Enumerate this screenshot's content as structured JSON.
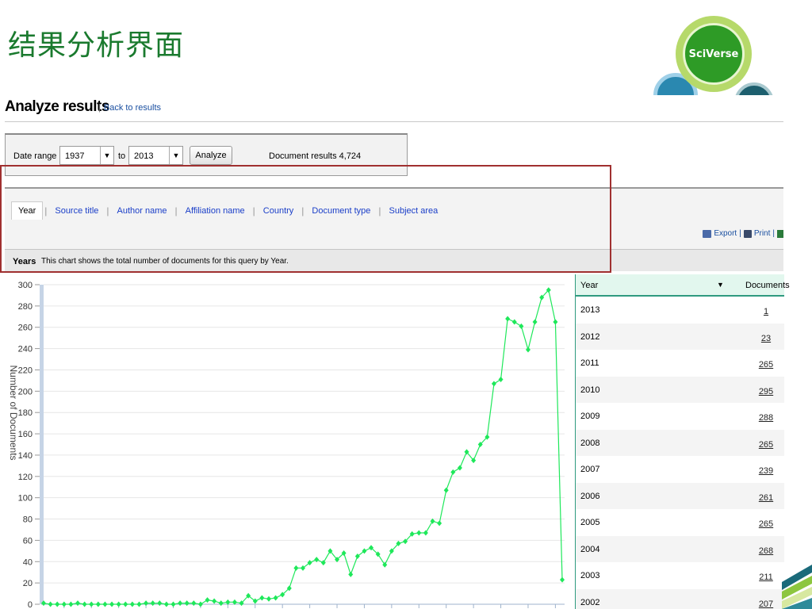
{
  "slide": {
    "title": "结果分析界面"
  },
  "logo": {
    "label": "SciVerse"
  },
  "page": {
    "title": "Analyze results",
    "back_link": "Back to results",
    "separator": "|"
  },
  "date_range": {
    "label": "Date range",
    "from": "1937",
    "to_label": "to",
    "to": "2013",
    "analyze_label": "Analyze",
    "document_results": "Document results 4,724"
  },
  "tabs": [
    {
      "label": "Year",
      "active": true
    },
    {
      "label": "Source title",
      "active": false
    },
    {
      "label": "Author name",
      "active": false
    },
    {
      "label": "Affiliation name",
      "active": false
    },
    {
      "label": "Country",
      "active": false
    },
    {
      "label": "Document type",
      "active": false
    },
    {
      "label": "Subject area",
      "active": false
    }
  ],
  "tools": {
    "export": "Export",
    "print": "Print"
  },
  "section": {
    "heading": "Years",
    "description": "This chart shows the total number of documents for this query by Year."
  },
  "chart_data": {
    "type": "line",
    "ylabel": "Number of Documents",
    "ylim": [
      0,
      300
    ],
    "yticks": [
      0,
      20,
      40,
      60,
      80,
      100,
      120,
      140,
      160,
      180,
      200,
      220,
      240,
      260,
      280,
      300
    ],
    "grid": true,
    "series_color": "#1ee85a",
    "x": [
      1937,
      1938,
      1939,
      1940,
      1941,
      1942,
      1943,
      1944,
      1945,
      1946,
      1947,
      1948,
      1949,
      1950,
      1951,
      1952,
      1953,
      1954,
      1955,
      1956,
      1957,
      1958,
      1959,
      1960,
      1961,
      1962,
      1963,
      1964,
      1965,
      1966,
      1967,
      1968,
      1969,
      1970,
      1971,
      1972,
      1973,
      1974,
      1975,
      1976,
      1977,
      1978,
      1979,
      1980,
      1981,
      1982,
      1983,
      1984,
      1985,
      1986,
      1987,
      1988,
      1989,
      1990,
      1991,
      1992,
      1993,
      1994,
      1995,
      1996,
      1997,
      1998,
      1999,
      2000,
      2001,
      2002,
      2003,
      2004,
      2005,
      2006,
      2007,
      2008,
      2009,
      2010,
      2011,
      2012,
      2013
    ],
    "y": [
      1,
      0,
      0,
      0,
      0,
      1,
      0,
      0,
      0,
      0,
      0,
      0,
      0,
      0,
      0,
      1,
      1,
      1,
      0,
      0,
      1,
      1,
      1,
      0,
      4,
      3,
      1,
      2,
      2,
      1,
      8,
      3,
      6,
      5,
      6,
      9,
      15,
      34,
      34,
      39,
      42,
      39,
      50,
      42,
      48,
      28,
      45,
      50,
      53,
      47,
      37,
      50,
      57,
      59,
      66,
      67,
      67,
      78,
      76,
      107,
      124,
      128,
      143,
      135,
      150,
      157,
      207,
      211,
      268,
      265,
      261,
      239,
      265,
      288,
      295,
      265,
      23,
      1
    ]
  },
  "table": {
    "headers": {
      "year": "Year",
      "documents": "Documents"
    },
    "rows": [
      {
        "year": "2013",
        "documents": "1"
      },
      {
        "year": "2012",
        "documents": "23"
      },
      {
        "year": "2011",
        "documents": "265"
      },
      {
        "year": "2010",
        "documents": "295"
      },
      {
        "year": "2009",
        "documents": "288"
      },
      {
        "year": "2008",
        "documents": "265"
      },
      {
        "year": "2007",
        "documents": "239"
      },
      {
        "year": "2006",
        "documents": "261"
      },
      {
        "year": "2005",
        "documents": "265"
      },
      {
        "year": "2004",
        "documents": "268"
      },
      {
        "year": "2003",
        "documents": "211"
      },
      {
        "year": "2002",
        "documents": "207"
      }
    ]
  }
}
